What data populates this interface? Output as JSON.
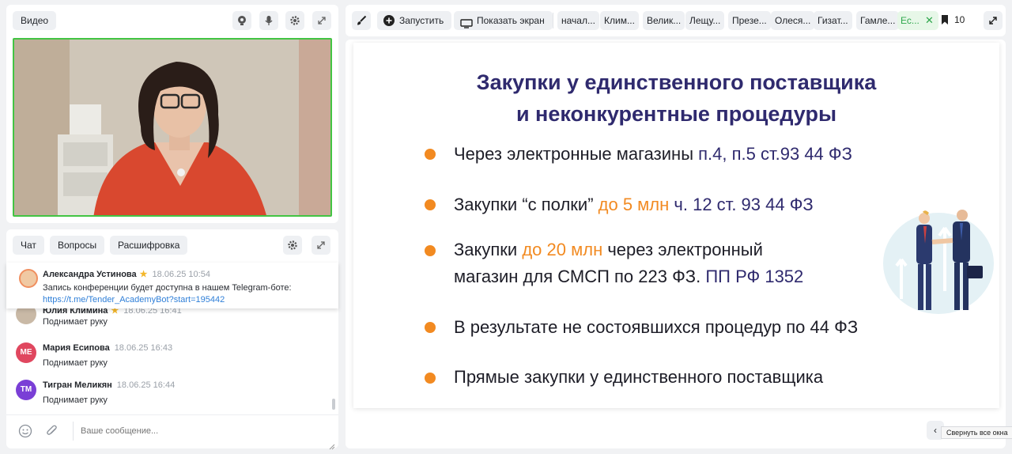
{
  "video_panel": {
    "title": "Видео"
  },
  "chat_panel": {
    "tabs": [
      "Чат",
      "Вопросы",
      "Расшифровка"
    ],
    "pinned": {
      "name": "Александра Устинова",
      "time": "18.06.25 10:54",
      "text": "Запись конференции будет доступна в нашем Telegram-боте:",
      "link": "https://t.me/Tender_AcademyBot?start=195442"
    },
    "messages": [
      {
        "name": "Юлия Климина",
        "time": "18.06.25 16:41",
        "text": "Поднимает руку",
        "initials": "",
        "color": "#c9b9a6"
      },
      {
        "name": "Мария Есипова",
        "time": "18.06.25 16:43",
        "text": "Поднимает руку",
        "initials": "МЕ",
        "color": "#e0475f"
      },
      {
        "name": "Тигран Меликян",
        "time": "18.06.25 16:44",
        "text": "Поднимает руку",
        "initials": "ТМ",
        "color": "#7a3fd6"
      }
    ],
    "input_placeholder": "Ваше сообщение..."
  },
  "toolbar": {
    "start_label": "Запустить",
    "share_label": "Показать экран",
    "tabs": [
      "начал...",
      "Клим...",
      "Велик...",
      "Лещу...",
      "Презе...",
      "Олеся...",
      "Гизат...",
      "Гамле...",
      "Ес..."
    ],
    "bookmark_count": "10"
  },
  "slide": {
    "title_line1": "Закупки у единственного поставщика",
    "title_line2": "и неконкурентные процедуры",
    "b1": {
      "a": "Через электронные магазины ",
      "b": "п.4, п.5 ст.93 44 ФЗ"
    },
    "b2": {
      "a": "Закупки “с полки” ",
      "b": "до 5 млн",
      "c": " ч. 12 ст. 93 44 ФЗ"
    },
    "b3": {
      "a": "Закупки ",
      "b": "до 20 млн",
      "c": " через электронный",
      "d": "магазин для СМСП по 223 ФЗ. ",
      "e": "ПП РФ 1352"
    },
    "b4": "В результате не состоявшихся процедур по 44 ФЗ",
    "b5": "Прямые закупки у единственного поставщика"
  },
  "tooltip": "Свернуть все окна",
  "colors": {
    "accent_green": "#42c443",
    "slide_navy": "#2f2a6e",
    "slide_orange": "#f28a21",
    "link": "#2f7fd8"
  }
}
